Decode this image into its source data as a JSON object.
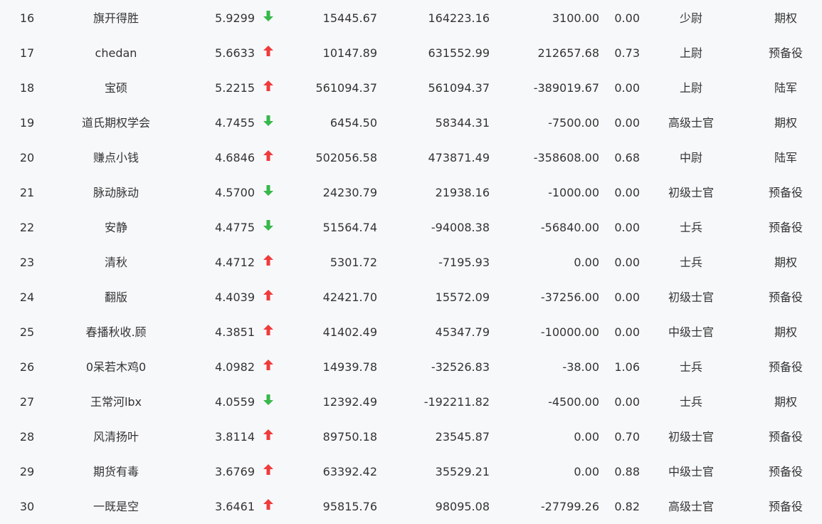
{
  "colors": {
    "background": "#f7f8fa",
    "text": "#333333",
    "up_arrow": "#f03b3b",
    "down_arrow": "#36b84a"
  },
  "rows": [
    {
      "rank": "16",
      "name": "旗开得胜",
      "ratio": "5.9299",
      "trend": "down",
      "v1": "15445.67",
      "v2": "164223.16",
      "v3": "3100.00",
      "v4": "0.00",
      "level": "少尉",
      "type": "期权"
    },
    {
      "rank": "17",
      "name": "chedan",
      "ratio": "5.6633",
      "trend": "up",
      "v1": "10147.89",
      "v2": "631552.99",
      "v3": "212657.68",
      "v4": "0.73",
      "level": "上尉",
      "type": "预备役"
    },
    {
      "rank": "18",
      "name": "宝硕",
      "ratio": "5.2215",
      "trend": "up",
      "v1": "561094.37",
      "v2": "561094.37",
      "v3": "-389019.67",
      "v4": "0.00",
      "level": "上尉",
      "type": "陆军"
    },
    {
      "rank": "19",
      "name": "道氏期权学会",
      "ratio": "4.7455",
      "trend": "down",
      "v1": "6454.50",
      "v2": "58344.31",
      "v3": "-7500.00",
      "v4": "0.00",
      "level": "高级士官",
      "type": "期权"
    },
    {
      "rank": "20",
      "name": "赚点小钱",
      "ratio": "4.6846",
      "trend": "up",
      "v1": "502056.58",
      "v2": "473871.49",
      "v3": "-358608.00",
      "v4": "0.68",
      "level": "中尉",
      "type": "陆军"
    },
    {
      "rank": "21",
      "name": "脉动脉动",
      "ratio": "4.5700",
      "trend": "down",
      "v1": "24230.79",
      "v2": "21938.16",
      "v3": "-1000.00",
      "v4": "0.00",
      "level": "初级士官",
      "type": "预备役"
    },
    {
      "rank": "22",
      "name": "安静",
      "ratio": "4.4775",
      "trend": "down",
      "v1": "51564.74",
      "v2": "-94008.38",
      "v3": "-56840.00",
      "v4": "0.00",
      "level": "士兵",
      "type": "预备役"
    },
    {
      "rank": "23",
      "name": "清秋",
      "ratio": "4.4712",
      "trend": "up",
      "v1": "5301.72",
      "v2": "-7195.93",
      "v3": "0.00",
      "v4": "0.00",
      "level": "士兵",
      "type": "期权"
    },
    {
      "rank": "24",
      "name": "翻版",
      "ratio": "4.4039",
      "trend": "up",
      "v1": "42421.70",
      "v2": "15572.09",
      "v3": "-37256.00",
      "v4": "0.00",
      "level": "初级士官",
      "type": "预备役"
    },
    {
      "rank": "25",
      "name": "春播秋收.顾",
      "ratio": "4.3851",
      "trend": "up",
      "v1": "41402.49",
      "v2": "45347.79",
      "v3": "-10000.00",
      "v4": "0.00",
      "level": "中级士官",
      "type": "期权"
    },
    {
      "rank": "26",
      "name": "0呆若木鸡0",
      "ratio": "4.0982",
      "trend": "up",
      "v1": "14939.78",
      "v2": "-32526.83",
      "v3": "-38.00",
      "v4": "1.06",
      "level": "士兵",
      "type": "预备役"
    },
    {
      "rank": "27",
      "name": "王常河lbx",
      "ratio": "4.0559",
      "trend": "down",
      "v1": "12392.49",
      "v2": "-192211.82",
      "v3": "-4500.00",
      "v4": "0.00",
      "level": "士兵",
      "type": "期权"
    },
    {
      "rank": "28",
      "name": "风清扬叶",
      "ratio": "3.8114",
      "trend": "up",
      "v1": "89750.18",
      "v2": "23545.87",
      "v3": "0.00",
      "v4": "0.70",
      "level": "初级士官",
      "type": "预备役"
    },
    {
      "rank": "29",
      "name": "期货有毒",
      "ratio": "3.6769",
      "trend": "up",
      "v1": "63392.42",
      "v2": "35529.21",
      "v3": "0.00",
      "v4": "0.88",
      "level": "中级士官",
      "type": "预备役"
    },
    {
      "rank": "30",
      "name": "一既是空",
      "ratio": "3.6461",
      "trend": "up",
      "v1": "95815.76",
      "v2": "98095.08",
      "v3": "-27799.26",
      "v4": "0.82",
      "level": "高级士官",
      "type": "预备役"
    }
  ]
}
